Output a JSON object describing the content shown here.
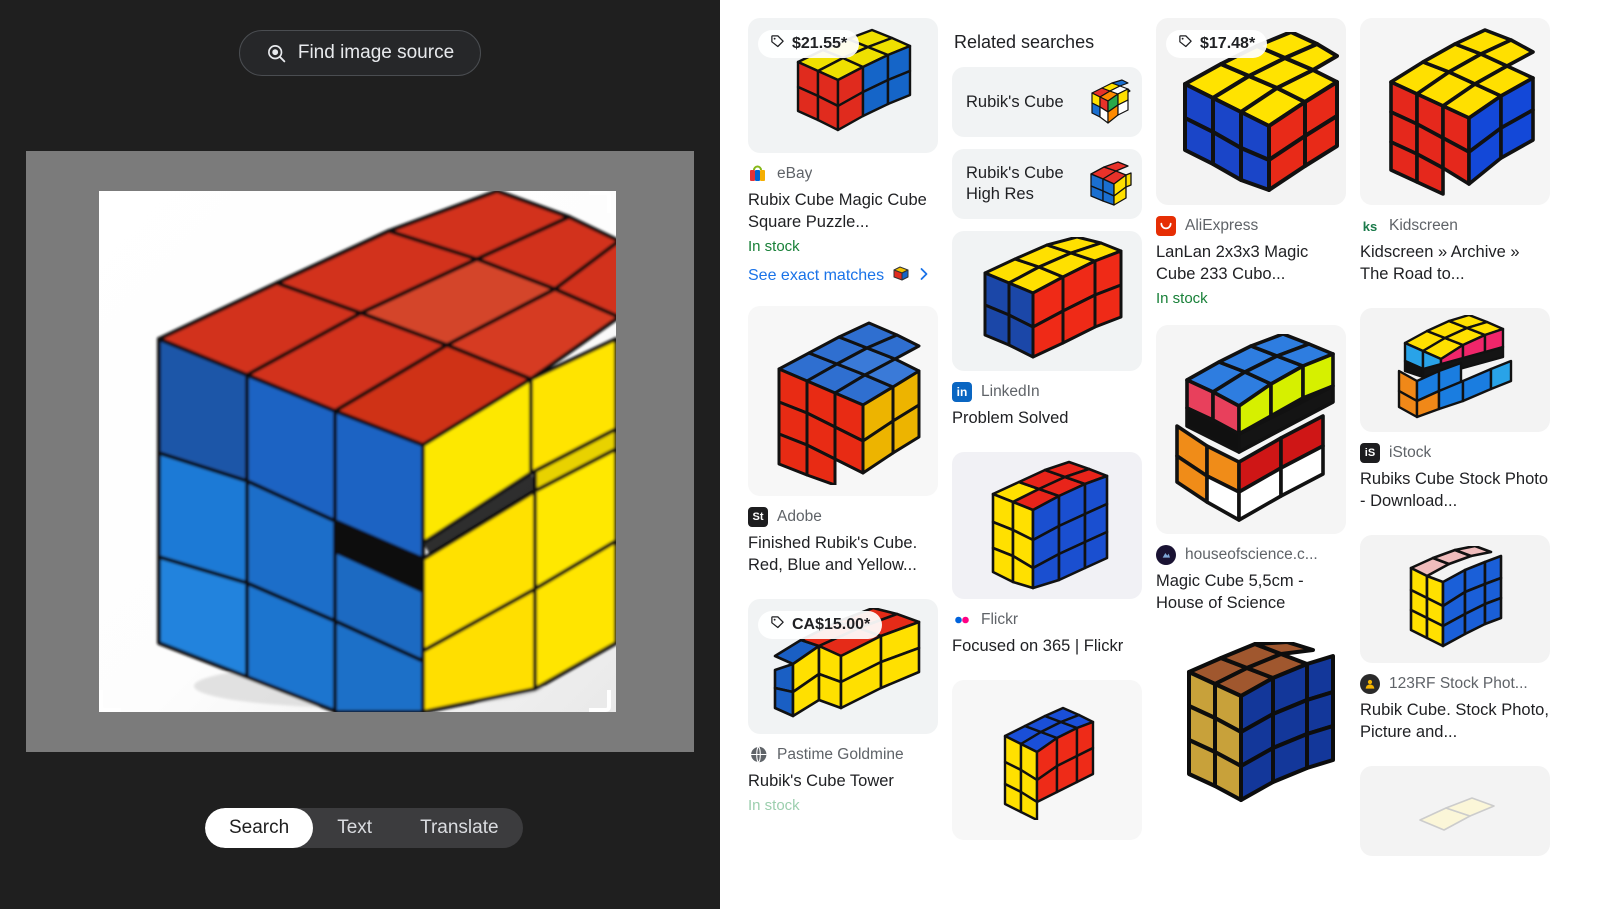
{
  "left": {
    "find_source_label": "Find image source",
    "find_source_icon": "search-image-icon",
    "modes": [
      {
        "label": "Search",
        "active": true
      },
      {
        "label": "Text",
        "active": false
      },
      {
        "label": "Translate",
        "active": false
      }
    ],
    "image": {
      "name": "rubiks-cube-photo",
      "description": "Rubik's Cube with red top, blue left and yellow right faces, middle layer rotated"
    },
    "crop_handles": [
      "top-left",
      "top-right",
      "bottom-left",
      "bottom-right"
    ]
  },
  "right": {
    "related": {
      "heading": "Related searches",
      "items": [
        {
          "label": "Rubik's Cube",
          "thumb": "rubiks-cube-multicolor-thumb"
        },
        {
          "label": "Rubik's Cube High Res",
          "thumb": "rubiks-cube-highres-thumb"
        }
      ]
    },
    "results": [
      {
        "id": "ebay-rubix-cube-magic",
        "price": "$21.55*",
        "source": "eBay",
        "favicon": "ebay-icon",
        "title": "Rubix Cube Magic Cube Square Puzzle...",
        "stock": "In stock",
        "exact_matches": "See exact matches",
        "thumb_height": 135,
        "thumb_bg": "#f1f3f4"
      },
      {
        "id": "adobe-finished-rubiks-cube",
        "price": null,
        "source": "Adobe",
        "favicon": "adobe-stock-icon",
        "title": "Finished Rubik's Cube. Red, Blue and Yellow...",
        "stock": null,
        "exact_matches": null,
        "thumb_height": 190,
        "thumb_bg": "#f7f7f7"
      },
      {
        "id": "pastime-goldmine-cube-tower",
        "price": "CA$15.00*",
        "source": "Pastime Goldmine",
        "favicon": "globe-icon",
        "title": "Rubik's Cube Tower",
        "stock": "In stock",
        "exact_matches": null,
        "thumb_height": 135,
        "thumb_bg": "#f1f3f4"
      },
      {
        "id": "linkedin-problem-solved",
        "price": null,
        "source": "LinkedIn",
        "favicon": "linkedin-icon",
        "title": "Problem Solved",
        "stock": null,
        "exact_matches": null,
        "thumb_height": 140,
        "thumb_bg": "#f1f3f4"
      },
      {
        "id": "flickr-focused-on-365",
        "price": null,
        "source": "Flickr",
        "favicon": "flickr-icon",
        "title": "Focused on 365 | Flickr",
        "stock": null,
        "exact_matches": null,
        "thumb_height": 147,
        "thumb_bg": "#f1f1f5"
      },
      {
        "id": "aliexpress-lanlan-2x3x3",
        "price": "$17.48*",
        "source": "AliExpress",
        "favicon": "aliexpress-icon",
        "title": "LanLan 2x3x3 Magic Cube 233 Cubo...",
        "stock": "In stock",
        "exact_matches": null,
        "thumb_height": 187,
        "thumb_bg": "#f3f3f3"
      },
      {
        "id": "houseofscience-magic-cube",
        "price": null,
        "source": "houseofscience.c...",
        "favicon": "houseofscience-icon",
        "title": "Magic Cube 5,5cm - House of Science",
        "stock": null,
        "exact_matches": null,
        "thumb_height": 209,
        "thumb_bg": "#f5f5f5"
      },
      {
        "id": "kidscreen-road-to",
        "price": null,
        "source": "Kidscreen",
        "favicon": "kidscreen-icon",
        "title": "Kidscreen » Archive » The Road to...",
        "stock": null,
        "exact_matches": null,
        "thumb_height": 187,
        "thumb_bg": "#f5f5f5"
      },
      {
        "id": "istock-rubiks-cube-stock-photo",
        "price": null,
        "source": "iStock",
        "favicon": "istock-icon",
        "title": "Rubiks Cube Stock Photo - Download...",
        "stock": null,
        "exact_matches": null,
        "thumb_height": 124,
        "thumb_bg": "#f3f3f3"
      },
      {
        "id": "123rf-rubik-cube-stock",
        "price": null,
        "source": "123RF Stock Phot...",
        "favicon": "123rf-icon",
        "title": "Rubik Cube. Stock Photo, Picture and...",
        "stock": null,
        "exact_matches": null,
        "thumb_height": 128,
        "thumb_bg": "#f3f3f3"
      }
    ],
    "partial_cards": [
      {
        "id": "shutterstock-partial",
        "thumb_bg": "#f7f7f7"
      },
      {
        "id": "dark-cube-partial",
        "thumb_bg": "#ffffff"
      },
      {
        "id": "bottom-partial",
        "thumb_bg": "#f3f3f3"
      }
    ]
  },
  "colors": {
    "left_bg": "#1f1f1f",
    "stage_bg": "#7b7b7b",
    "link_blue": "#1a73e8",
    "stock_green": "#188038",
    "card_bg": "#f1f3f4",
    "cube_red": "#d7301a",
    "cube_blue": "#1565c8",
    "cube_yellow": "#ffe000"
  }
}
